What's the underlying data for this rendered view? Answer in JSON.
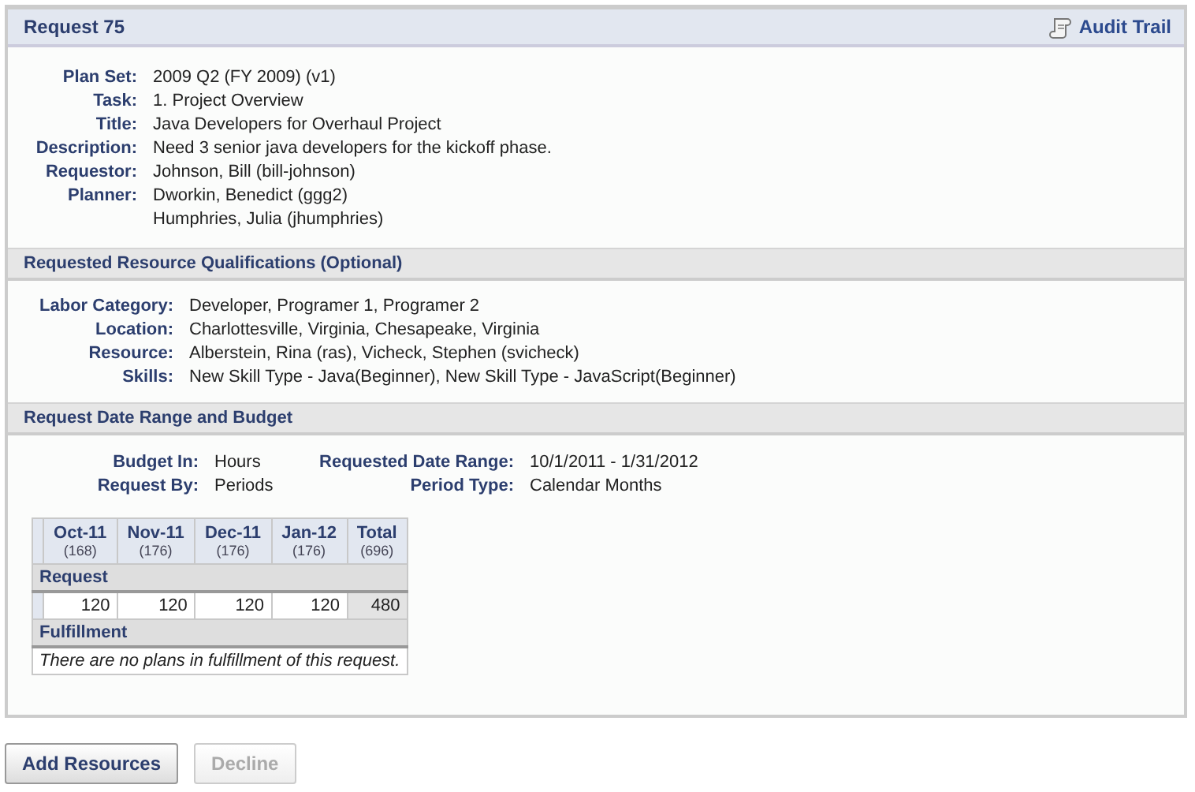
{
  "panel": {
    "title": "Request 75",
    "audit_link": "Audit Trail"
  },
  "details": [
    {
      "label": "Plan Set:",
      "values": [
        "2009 Q2 (FY 2009) (v1)"
      ]
    },
    {
      "label": "Task:",
      "values": [
        "1. Project Overview"
      ]
    },
    {
      "label": "Title:",
      "values": [
        "Java Developers for Overhaul Project"
      ]
    },
    {
      "label": "Description:",
      "values": [
        "Need 3 senior java developers for the kickoff phase."
      ]
    },
    {
      "label": "Requestor:",
      "values": [
        "Johnson, Bill (bill-johnson)"
      ]
    },
    {
      "label": "Planner:",
      "values": [
        "Dworkin, Benedict (ggg2)",
        "Humphries, Julia (jhumphries)"
      ]
    }
  ],
  "qualifications": {
    "title": "Requested Resource Qualifications (Optional)",
    "rows": [
      {
        "label": "Labor Category:",
        "value": "Developer, Programer 1, Programer 2"
      },
      {
        "label": "Location:",
        "value": "Charlottesville, Virginia, Chesapeake, Virginia"
      },
      {
        "label": "Resource:",
        "value": "Alberstein, Rina (ras), Vicheck, Stephen (svicheck)"
      },
      {
        "label": "Skills:",
        "value": "New Skill Type - Java(Beginner), New Skill Type - JavaScript(Beginner)"
      }
    ]
  },
  "budget": {
    "title": "Request Date Range and Budget",
    "rows": [
      [
        {
          "label": "Budget In:",
          "value": "Hours"
        },
        {
          "label": "Requested Date Range:",
          "value": "10/1/2011 - 1/31/2012"
        }
      ],
      [
        {
          "label": "Request By:",
          "value": "Periods"
        },
        {
          "label": "Period Type:",
          "value": "Calendar Months"
        }
      ]
    ]
  },
  "table": {
    "columns": [
      {
        "month": "Oct-11",
        "hours": "(168)"
      },
      {
        "month": "Nov-11",
        "hours": "(176)"
      },
      {
        "month": "Dec-11",
        "hours": "(176)"
      },
      {
        "month": "Jan-12",
        "hours": "(176)"
      },
      {
        "month": "Total",
        "hours": "(696)"
      }
    ],
    "sections": [
      {
        "title": "Request",
        "kind": "values",
        "values": [
          "120",
          "120",
          "120",
          "120",
          "480"
        ]
      },
      {
        "title": "Fulfillment",
        "kind": "message",
        "message": "There are no plans in fulfillment of this request."
      }
    ]
  },
  "buttons": [
    {
      "label": "Add Resources",
      "disabled": false
    },
    {
      "label": "Decline",
      "disabled": true
    }
  ]
}
